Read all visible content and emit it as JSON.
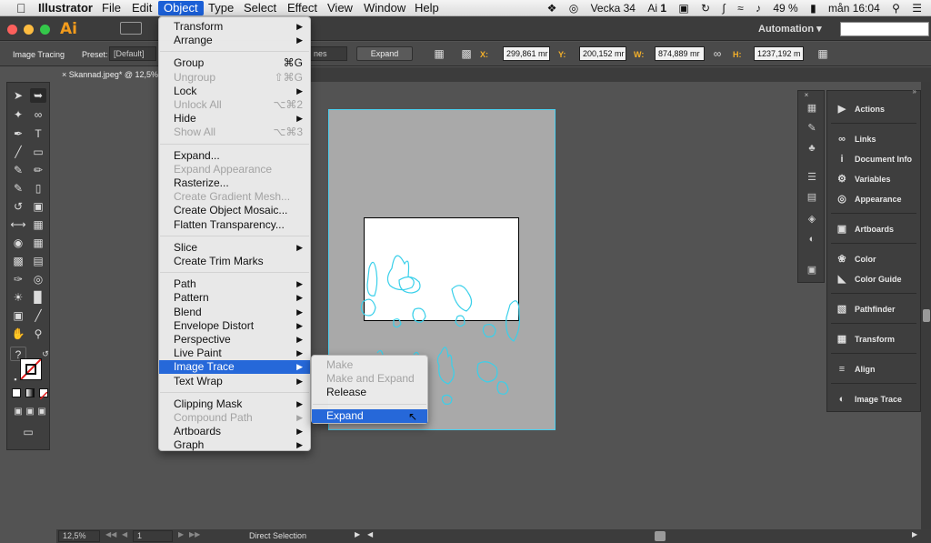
{
  "menubar": {
    "apple": "",
    "app_name": "Illustrator",
    "items": [
      "File",
      "Edit",
      "Object",
      "Type",
      "Select",
      "Effect",
      "View",
      "Window",
      "Help"
    ],
    "active": "Object",
    "status": {
      "week": "Vecka 34",
      "ai_indicator": "1",
      "battery": "49 %",
      "clock": "mån 16:04"
    }
  },
  "appbar": {
    "logo": "Ai",
    "workspace": "Automation"
  },
  "control_bar": {
    "section_label": "Image Tracing",
    "preset_label": "Preset:",
    "preset_value": "[Default]",
    "view_value": "nes",
    "expand_button": "Expand",
    "x_label": "X:",
    "x_value": "299,861 mr",
    "y_label": "Y:",
    "y_value": "200,152 mr",
    "w_label": "W:",
    "w_value": "874,889 mr",
    "h_label": "H:",
    "h_value": "1237,192 m"
  },
  "document": {
    "tab_title": "Skannad.jpeg* @ 12,5%"
  },
  "object_menu": {
    "items": [
      {
        "label": "Transform",
        "submenu": true,
        "disabled": false
      },
      {
        "label": "Arrange",
        "submenu": true,
        "disabled": false
      },
      {
        "sep": true
      },
      {
        "label": "Group",
        "shortcut": "⌘G",
        "disabled": false
      },
      {
        "label": "Ungroup",
        "shortcut": "⇧⌘G",
        "disabled": true
      },
      {
        "label": "Lock",
        "submenu": true,
        "disabled": false
      },
      {
        "label": "Unlock All",
        "shortcut": "⌥⌘2",
        "disabled": true
      },
      {
        "label": "Hide",
        "submenu": true,
        "disabled": false
      },
      {
        "label": "Show All",
        "shortcut": "⌥⌘3",
        "disabled": true
      },
      {
        "sep": true
      },
      {
        "label": "Expand...",
        "disabled": false
      },
      {
        "label": "Expand Appearance",
        "disabled": true
      },
      {
        "label": "Rasterize...",
        "disabled": false
      },
      {
        "label": "Create Gradient Mesh...",
        "disabled": true
      },
      {
        "label": "Create Object Mosaic...",
        "disabled": false
      },
      {
        "label": "Flatten Transparency...",
        "disabled": false
      },
      {
        "sep": true
      },
      {
        "label": "Slice",
        "submenu": true,
        "disabled": false
      },
      {
        "label": "Create Trim Marks",
        "disabled": false
      },
      {
        "sep": true
      },
      {
        "label": "Path",
        "submenu": true,
        "disabled": false
      },
      {
        "label": "Pattern",
        "submenu": true,
        "disabled": false
      },
      {
        "label": "Blend",
        "submenu": true,
        "disabled": false
      },
      {
        "label": "Envelope Distort",
        "submenu": true,
        "disabled": false
      },
      {
        "label": "Perspective",
        "submenu": true,
        "disabled": false
      },
      {
        "label": "Live Paint",
        "submenu": true,
        "disabled": false
      },
      {
        "label": "Image Trace",
        "submenu": true,
        "disabled": false,
        "highlighted": true
      },
      {
        "label": "Text Wrap",
        "submenu": true,
        "disabled": false
      },
      {
        "sep": true
      },
      {
        "label": "Clipping Mask",
        "submenu": true,
        "disabled": false
      },
      {
        "label": "Compound Path",
        "submenu": true,
        "disabled": true
      },
      {
        "label": "Artboards",
        "submenu": true,
        "disabled": false
      },
      {
        "label": "Graph",
        "submenu": true,
        "disabled": false
      }
    ]
  },
  "image_trace_submenu": {
    "items": [
      {
        "label": "Make",
        "disabled": true
      },
      {
        "label": "Make and Expand",
        "disabled": true
      },
      {
        "label": "Release",
        "disabled": false
      },
      {
        "sep": true
      },
      {
        "label": "Expand",
        "disabled": false,
        "highlighted": true
      }
    ]
  },
  "panels": {
    "items": [
      {
        "label": "Actions",
        "icon": "play-icon"
      },
      {
        "label": "Links",
        "icon": "link-icon"
      },
      {
        "label": "Document Info",
        "icon": "info-icon"
      },
      {
        "label": "Variables",
        "icon": "variables-icon"
      },
      {
        "label": "Appearance",
        "icon": "appearance-icon"
      },
      {
        "label": "Artboards",
        "icon": "artboards-icon"
      },
      {
        "label": "Color",
        "icon": "color-icon"
      },
      {
        "label": "Color Guide",
        "icon": "color-guide-icon"
      },
      {
        "label": "Pathfinder",
        "icon": "pathfinder-icon"
      },
      {
        "label": "Transform",
        "icon": "transform-icon"
      },
      {
        "label": "Align",
        "icon": "align-icon"
      },
      {
        "label": "Image Trace",
        "icon": "image-trace-icon"
      }
    ]
  },
  "bottom_bar": {
    "zoom": "12,5%",
    "artboard_num": "1",
    "tool_status": "Direct Selection"
  }
}
